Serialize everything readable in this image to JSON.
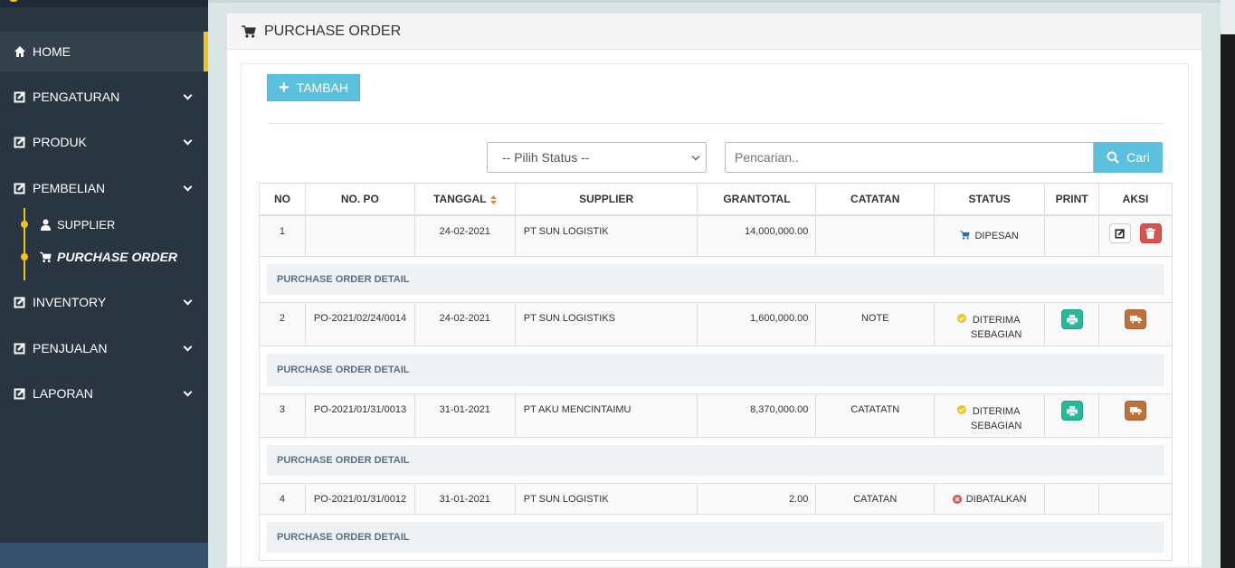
{
  "sidebar": {
    "items": [
      {
        "label": "HOME"
      },
      {
        "label": "PENGATURAN"
      },
      {
        "label": "PRODUK"
      },
      {
        "label": "PEMBELIAN"
      },
      {
        "label": "INVENTORY"
      },
      {
        "label": "PENJUALAN"
      },
      {
        "label": "LAPORAN"
      }
    ],
    "submenu": [
      {
        "label": "SUPPLIER"
      },
      {
        "label": "PURCHASE ORDER"
      }
    ],
    "accent_color": "#f0c419"
  },
  "panel": {
    "title": "PURCHASE ORDER",
    "add_button": "TAMBAH",
    "status_select": "-- Pilih Status --",
    "search_placeholder": "Pencarian..",
    "search_button": "Cari"
  },
  "table": {
    "headers": [
      "NO",
      "NO. PO",
      "TANGGAL",
      "SUPPLIER",
      "GRANTOTAL",
      "CATATAN",
      "STATUS",
      "PRINT",
      "AKSI"
    ],
    "detail_label": "PURCHASE ORDER DETAIL",
    "rows": [
      {
        "no": "1",
        "po": "",
        "tanggal": "24-02-2021",
        "supplier": "PT SUN LOGISTIK",
        "grantotal": "14,000,000.00",
        "catatan": "",
        "status_1": "DIPESAN",
        "status_2": ""
      },
      {
        "no": "2",
        "po": "PO-2021/02/24/0014",
        "tanggal": "24-02-2021",
        "supplier": "PT SUN LOGISTIKS",
        "grantotal": "1,600,000.00",
        "catatan": "NOTE",
        "status_1": "DITERIMA",
        "status_2": "SEBAGIAN"
      },
      {
        "no": "3",
        "po": "PO-2021/01/31/0013",
        "tanggal": "31-01-2021",
        "supplier": "PT AKU MENCINTAIMU",
        "grantotal": "8,370,000.00",
        "catatan": "CATATATN",
        "status_1": "DITERIMA",
        "status_2": "SEBAGIAN"
      },
      {
        "no": "4",
        "po": "PO-2021/01/31/0012",
        "tanggal": "31-01-2021",
        "supplier": "PT SUN LOGISTIK",
        "grantotal": "2.00",
        "catatan": "CATATAN",
        "status_1": "DIBATALKAN",
        "status_2": ""
      }
    ]
  },
  "colors": {
    "sidebar_bg": "#2a3542",
    "info": "#5bc0de",
    "danger": "#d9534f",
    "success": "#26b99a",
    "warning": "#c0703a"
  },
  "icons": [
    "home-icon",
    "edit-icon",
    "user-icon",
    "cart-icon",
    "plus-icon",
    "search-icon",
    "sort-icon",
    "check-circle-icon",
    "times-circle-icon",
    "print-icon",
    "truck-icon",
    "trash-icon"
  ]
}
